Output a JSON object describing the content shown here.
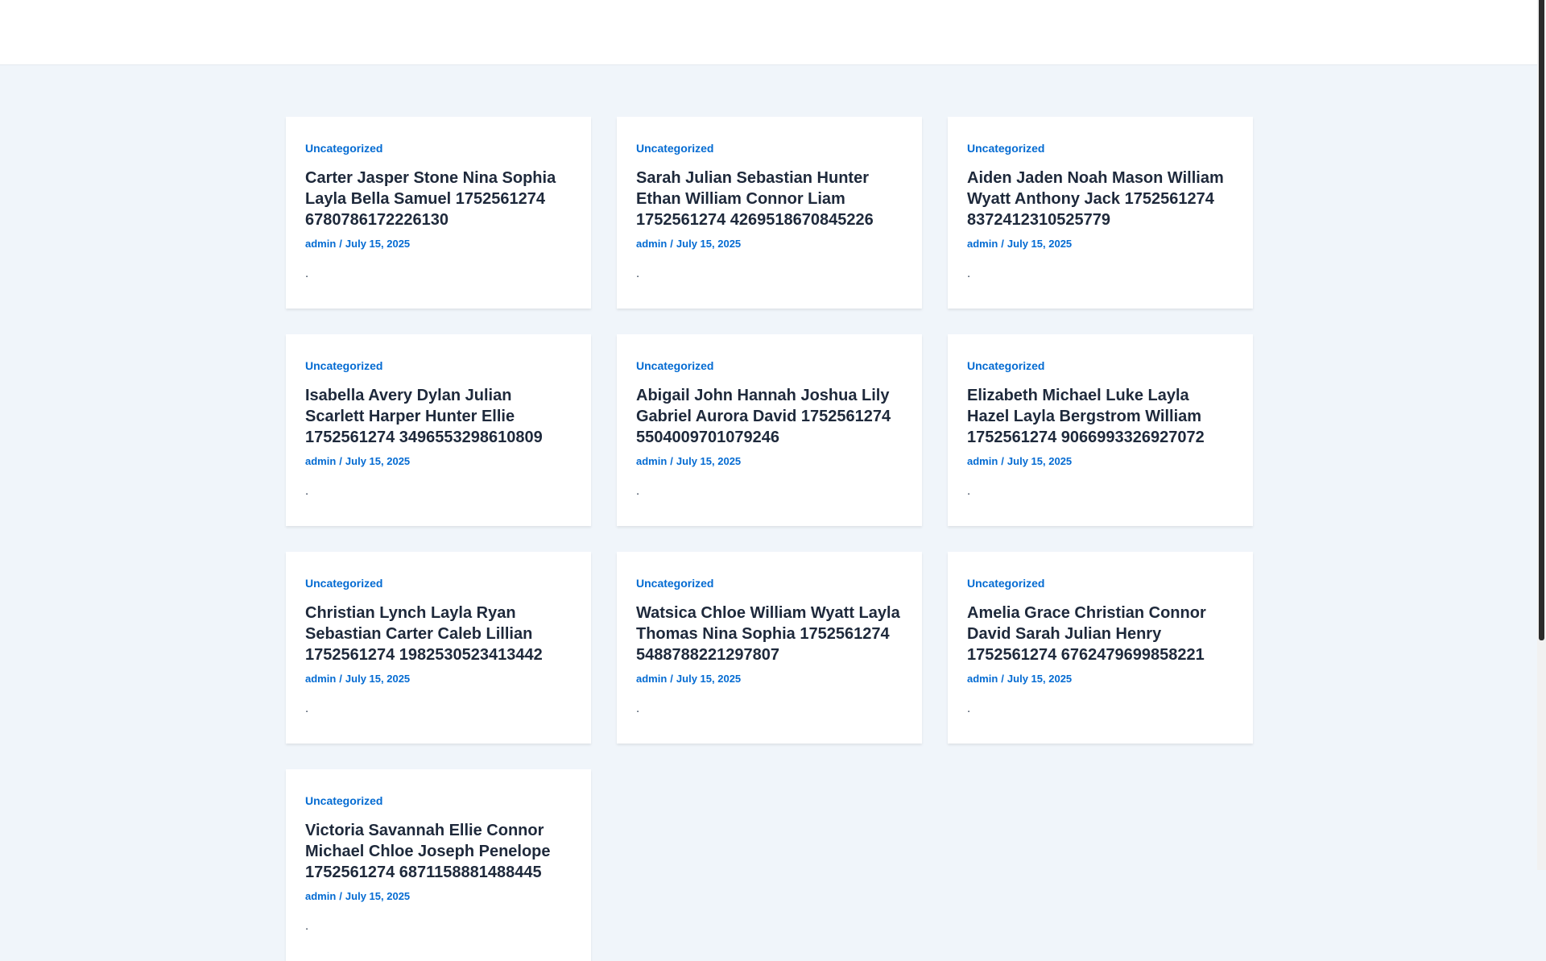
{
  "posts": [
    {
      "category": "Uncategorized",
      "title": "Carter Jasper Stone Nina Sophia Layla Bella Samuel 1752561274 6780786172226130",
      "author": "admin",
      "separator": "/",
      "date": "July 15, 2025",
      "excerpt": "."
    },
    {
      "category": "Uncategorized",
      "title": "Sarah Julian Sebastian Hunter Ethan William Connor Liam 1752561274 4269518670845226",
      "author": "admin",
      "separator": "/",
      "date": "July 15, 2025",
      "excerpt": "."
    },
    {
      "category": "Uncategorized",
      "title": "Aiden Jaden Noah Mason William Wyatt Anthony Jack 1752561274 8372412310525779",
      "author": "admin",
      "separator": "/",
      "date": "July 15, 2025",
      "excerpt": "."
    },
    {
      "category": "Uncategorized",
      "title": "Isabella Avery Dylan Julian Scarlett Harper Hunter Ellie 1752561274 3496553298610809",
      "author": "admin",
      "separator": "/",
      "date": "July 15, 2025",
      "excerpt": "."
    },
    {
      "category": "Uncategorized",
      "title": "Abigail John Hannah Joshua Lily Gabriel Aurora David 1752561274 5504009701079246",
      "author": "admin",
      "separator": "/",
      "date": "July 15, 2025",
      "excerpt": "."
    },
    {
      "category": "Uncategorized",
      "title": "Elizabeth Michael Luke Layla Hazel Layla Bergstrom William 1752561274 9066993326927072",
      "author": "admin",
      "separator": "/",
      "date": "July 15, 2025",
      "excerpt": "."
    },
    {
      "category": "Uncategorized",
      "title": "Christian Lynch Layla Ryan Sebastian Carter Caleb Lillian 1752561274 1982530523413442",
      "author": "admin",
      "separator": "/",
      "date": "July 15, 2025",
      "excerpt": "."
    },
    {
      "category": "Uncategorized",
      "title": "Watsica Chloe William Wyatt Layla Thomas Nina Sophia 1752561274 5488788221297807",
      "author": "admin",
      "separator": "/",
      "date": "July 15, 2025",
      "excerpt": "."
    },
    {
      "category": "Uncategorized",
      "title": "Amelia Grace Christian Connor David Sarah Julian Henry 1752561274 6762479699858221",
      "author": "admin",
      "separator": "/",
      "date": "July 15, 2025",
      "excerpt": "."
    },
    {
      "category": "Uncategorized",
      "title": "Victoria Savannah Ellie Connor Michael Chloe Joseph Penelope 1752561274 6871158881488445",
      "author": "admin",
      "separator": "/",
      "date": "July 15, 2025",
      "excerpt": "."
    }
  ],
  "colors": {
    "accent": "#046bd2",
    "heading": "#1e293b",
    "background": "#f0f5fa",
    "card": "#ffffff"
  }
}
